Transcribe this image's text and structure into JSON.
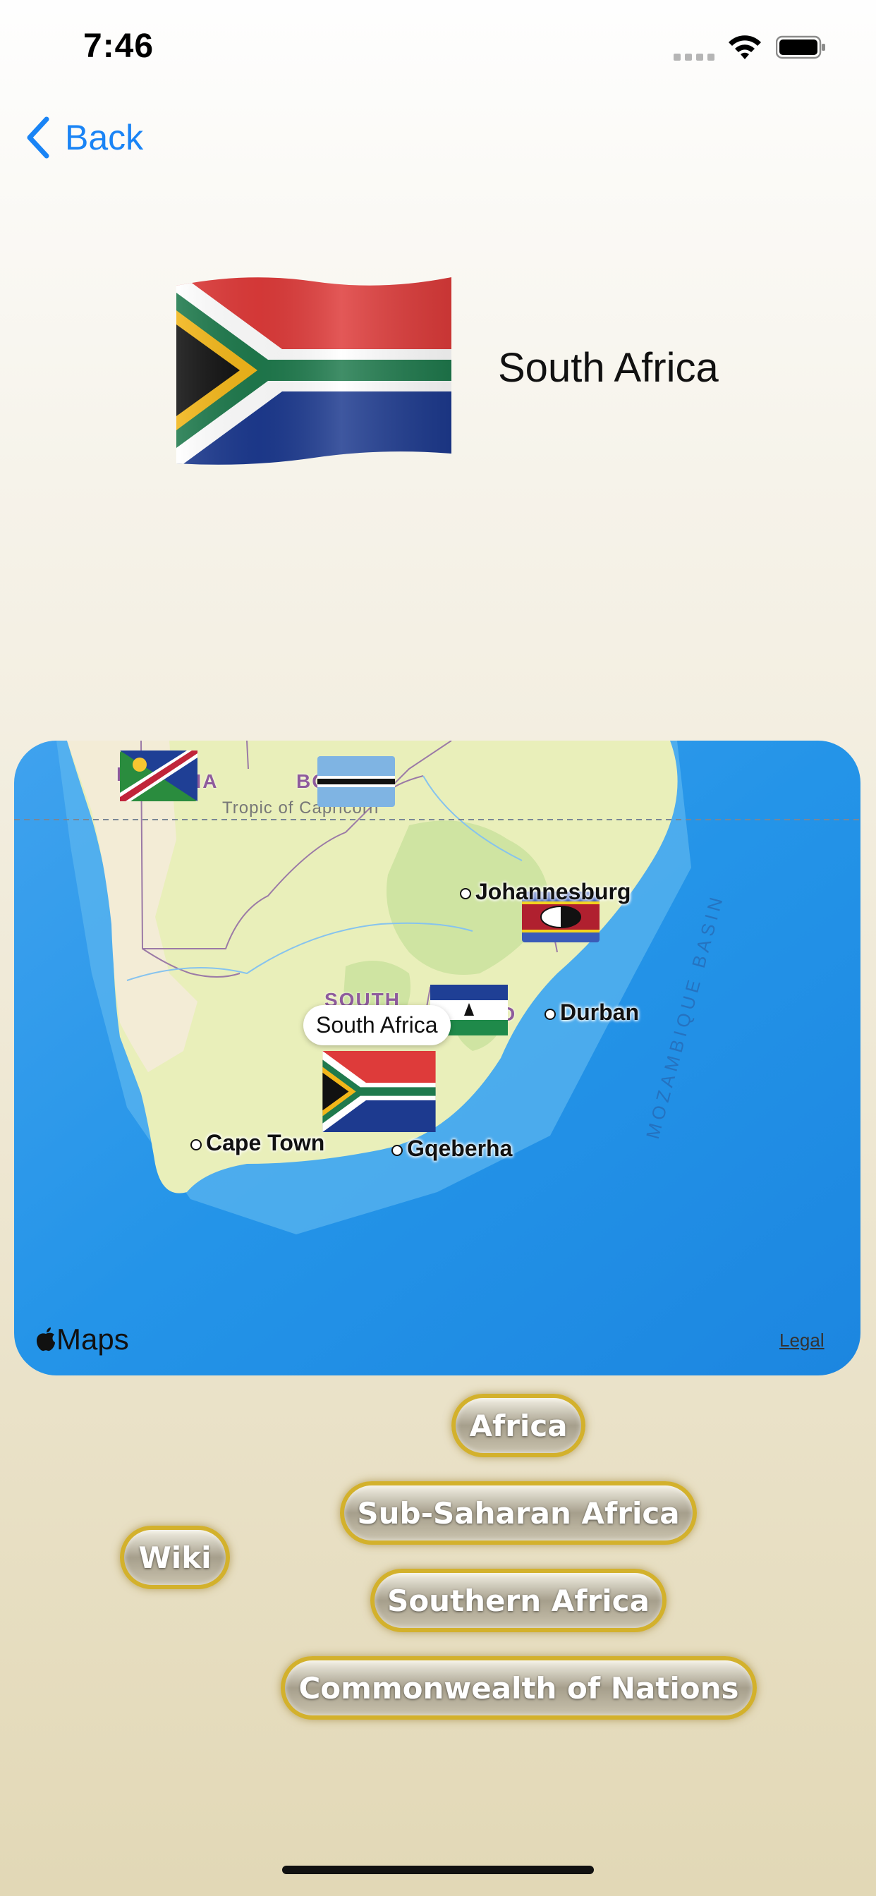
{
  "status": {
    "time": "7:46"
  },
  "nav": {
    "back_label": "Back"
  },
  "country": {
    "name": "South Africa",
    "flag": "south-africa-flag"
  },
  "map": {
    "callout": "South Africa",
    "cities": [
      "Johannesburg",
      "Durban",
      "Cape Town",
      "Gqeberha"
    ],
    "regions": [
      "NA",
      "BO",
      "NA",
      "SOUTH",
      "D"
    ],
    "tropic_label": "Tropic of Capricorn",
    "basin_label": "MOZAMBIQUE BASIN",
    "logo_label": "Maps",
    "legal_label": "Legal",
    "flags": [
      "namibia-flag",
      "botswana-flag",
      "eswatini-flag",
      "lesotho-flag",
      "south-africa-flag"
    ]
  },
  "tags": {
    "wiki": "Wiki",
    "groups": [
      "Africa",
      "Sub-Saharan Africa",
      "Southern Africa",
      "Commonwealth of Nations"
    ]
  },
  "colors": {
    "accent": "#1a84f5",
    "tag_border": "#d3b12c",
    "ocean": "#1e8fe6",
    "land": "#e8efb6"
  }
}
